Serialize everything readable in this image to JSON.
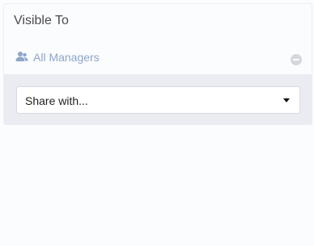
{
  "panel": {
    "title": "Visible To",
    "audience": {
      "label": "All Managers",
      "icon": "users-icon",
      "remove_icon": "minus-circle-icon"
    },
    "share": {
      "selected": "Share with...",
      "icon": "caret-down-icon"
    }
  },
  "colors": {
    "background": "#fbfcfe",
    "share_area": "#ebecf1",
    "audience_text": "#8ea6c8",
    "title_text": "#4a4a4f"
  }
}
